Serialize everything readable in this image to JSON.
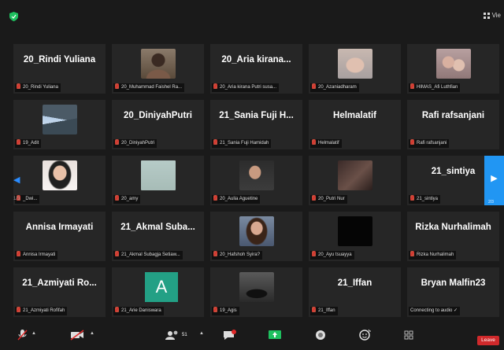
{
  "header": {
    "view_label": "Vie"
  },
  "participants": [
    {
      "name": "20_Rindi Yuliana",
      "label": "20_Rindi Yuliana"
    },
    {
      "name": "",
      "label": "20_Muhammad Faishel Ra...",
      "photo": "ph-person"
    },
    {
      "name": "20_Aria  kirana...",
      "label": "20_Aria kirana Putri susa..."
    },
    {
      "name": "",
      "label": "20_Azaniadharam",
      "photo": "ph-baby"
    },
    {
      "name": "",
      "label": "HIMAS_Afi Luthfian",
      "photo": "ph-couple"
    },
    {
      "name": "",
      "label": "19_Adit",
      "photo": "ph-mountain"
    },
    {
      "name": "20_DiniyahPutri",
      "label": "20_DiniyahPutri"
    },
    {
      "name": "21_Sania Fuji H...",
      "label": "21_Sania Fuji Hamidah"
    },
    {
      "name": "Helmalatif",
      "label": "Helmalatif"
    },
    {
      "name": "Rafi rafsanjani",
      "label": "Rafi rafsanjani"
    },
    {
      "name": "",
      "label": "_Dwi...",
      "photo": "ph-hijab"
    },
    {
      "name": "",
      "label": "20_amy",
      "photo": "ph-blur"
    },
    {
      "name": "",
      "label": "20_Aulia Aguetine",
      "photo": "ph-man"
    },
    {
      "name": "",
      "label": "20_Putri Nur",
      "photo": "ph-dark"
    },
    {
      "name": "21_sintiya",
      "label": "21_sintiya"
    },
    {
      "name": "Annisa Irmayati",
      "label": "Annisa Irmayati"
    },
    {
      "name": "21_Akmal  Suba...",
      "label": "21_Akmal Subagja Setiaw..."
    },
    {
      "name": "",
      "label": "20_Hafshoh Syira?",
      "photo": "ph-woman"
    },
    {
      "name": "",
      "label": "20_Ayu tsuayya",
      "photo": "ph-black"
    },
    {
      "name": "Rizka Nurhalimah",
      "label": "Rizka Nurhalimah"
    },
    {
      "name": "21_Azmiyati  Ro...",
      "label": "21_Azmiyati Rofifah"
    },
    {
      "name": "",
      "label": "21_Arie Daniswara",
      "avatar_letter": "A"
    },
    {
      "name": "",
      "label": "19_Agis",
      "photo": "ph-moto"
    },
    {
      "name": "21_Iffan",
      "label": "21_Iffan"
    },
    {
      "name": "Bryan Malfin23",
      "label": "Connecting to audio ✓",
      "no_mic": true
    }
  ],
  "navigation": {
    "left_arrow": "◀",
    "right_arrow": "▶",
    "page_left": "1/3",
    "page_right": "2/3"
  },
  "toolbar": {
    "participants_count": "51",
    "leave_label": "Leave"
  },
  "colors": {
    "accent": "#2196f3",
    "leave": "#d0292b",
    "tile_bg": "#262626",
    "share_green": "#1ec15f",
    "avatar_teal": "#23a085"
  }
}
